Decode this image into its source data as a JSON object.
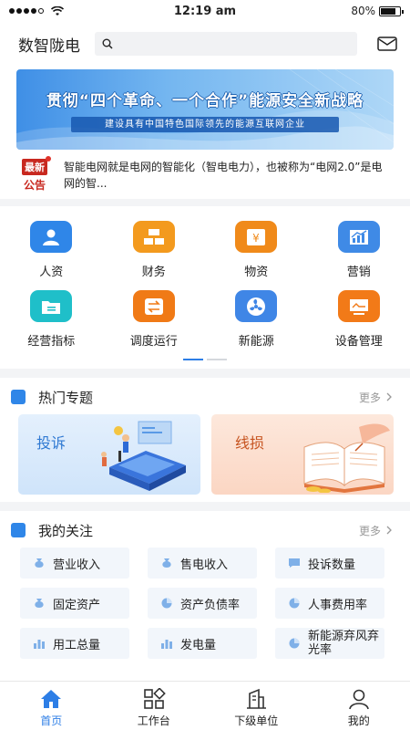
{
  "status": {
    "time": "12:19 am",
    "battery": "80%",
    "battery_level": 0.8
  },
  "header": {
    "title": "数智陇电",
    "search_placeholder": ""
  },
  "banner": {
    "title": "贯彻“四个革命、一个合作”能源安全新战略",
    "subtitle": "建设具有中国特色国际领先的能源互联网企业"
  },
  "notice": {
    "badge_top": "最新",
    "badge_bottom": "公告",
    "text": "智能电网就是电网的智能化（智电电力），也被称为“电网2.0”是电网的智..."
  },
  "categories": [
    {
      "label": "人资",
      "icon": "person-icon",
      "color": "#2f86e8"
    },
    {
      "label": "财务",
      "icon": "finance-icon",
      "color": "#f39a1e"
    },
    {
      "label": "物资",
      "icon": "materials-icon",
      "color": "#f08a1a"
    },
    {
      "label": "营销",
      "icon": "marketing-chart-icon",
      "color": "#3f8ae6"
    },
    {
      "label": "经营指标",
      "icon": "folder-icon",
      "color": "#1fbfc9"
    },
    {
      "label": "调度运行",
      "icon": "dispatch-icon",
      "color": "#f07a16"
    },
    {
      "label": "新能源",
      "icon": "fan-icon",
      "color": "#3f86e6"
    },
    {
      "label": "设备管理",
      "icon": "monitor-icon",
      "color": "#f27a18"
    }
  ],
  "hot": {
    "title": "热门专题",
    "more": "更多",
    "topics": [
      {
        "label": "投诉"
      },
      {
        "label": "线损"
      }
    ]
  },
  "follow": {
    "title": "我的关注",
    "more": "更多",
    "items": [
      {
        "label": "营业收入",
        "icon": "money-bag-icon"
      },
      {
        "label": "售电收入",
        "icon": "money-bag-icon"
      },
      {
        "label": "投诉数量",
        "icon": "message-icon"
      },
      {
        "label": "固定资产",
        "icon": "money-bag-icon"
      },
      {
        "label": "资产负债率",
        "icon": "pie-chart-icon"
      },
      {
        "label": "人事费用率",
        "icon": "pie-chart-icon"
      },
      {
        "label": "用工总量",
        "icon": "bar-chart-icon"
      },
      {
        "label": "发电量",
        "icon": "bar-chart-icon"
      },
      {
        "label": "新能源弃风弃光率",
        "icon": "pie-chart-icon"
      }
    ]
  },
  "tabs": [
    {
      "label": "首页",
      "icon": "home-icon",
      "active": true
    },
    {
      "label": "工作台",
      "icon": "workbench-icon",
      "active": false
    },
    {
      "label": "下级单位",
      "icon": "building-icon",
      "active": false
    },
    {
      "label": "我的",
      "icon": "user-icon",
      "active": false
    }
  ]
}
